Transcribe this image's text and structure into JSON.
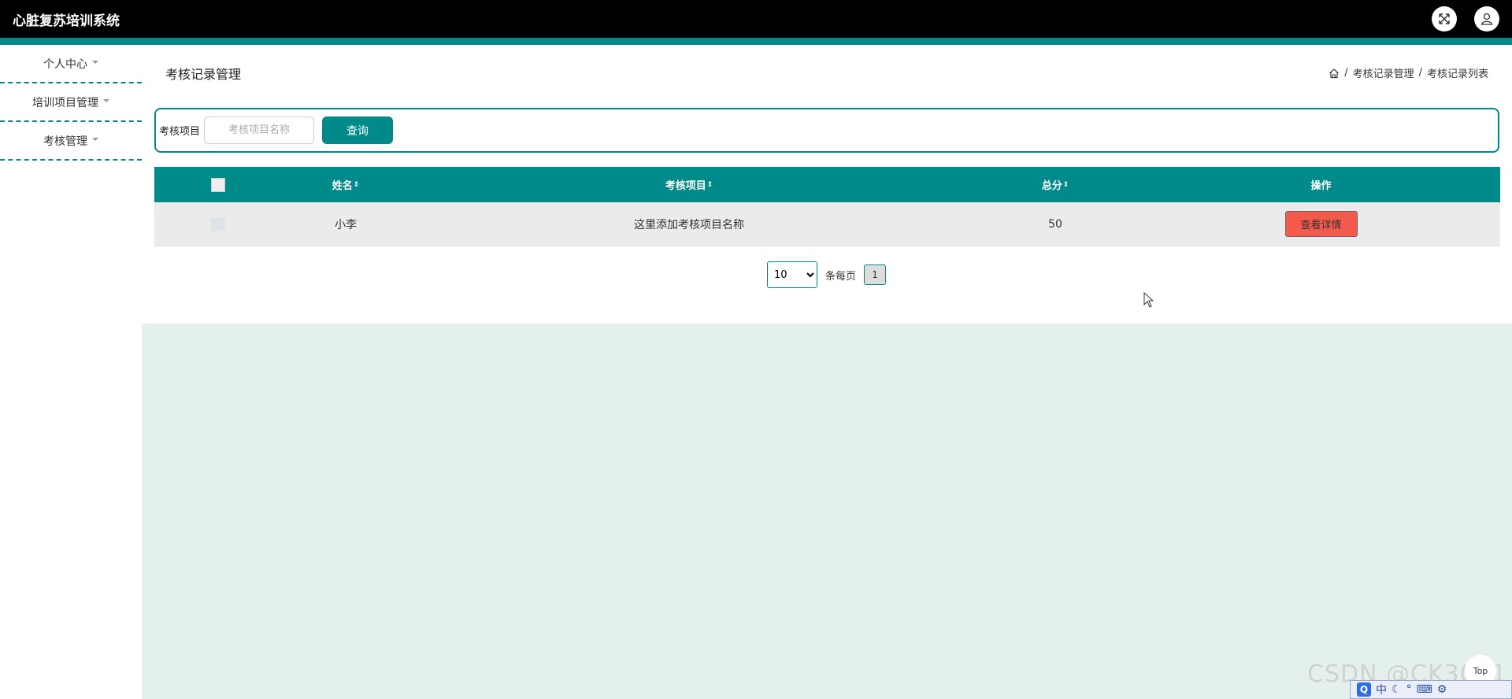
{
  "app": {
    "title": "心脏复苏培训系统"
  },
  "topbar_icons": [
    "fullscreen-icon",
    "user-icon"
  ],
  "sidebar": {
    "items": [
      {
        "label": "个人中心"
      },
      {
        "label": "培训项目管理"
      },
      {
        "label": "考核管理"
      }
    ]
  },
  "page": {
    "title": "考核记录管理",
    "breadcrumb": [
      "考核记录管理",
      "考核记录列表"
    ],
    "breadcrumb_sep": "/"
  },
  "search": {
    "label": "考核项目",
    "placeholder": "考核项目名称",
    "button": "查询"
  },
  "table": {
    "columns": [
      "姓名",
      "考核项目",
      "总分",
      "操作"
    ],
    "sort_icon": "⇕",
    "rows": [
      {
        "name": "小李",
        "project": "这里添加考核项目名称",
        "score": "50",
        "action": "查看详情"
      }
    ]
  },
  "pagination": {
    "page_size": "10",
    "page_size_options": [
      "10"
    ],
    "per_page_label": "条每页",
    "current_page": "1"
  },
  "overlay": {
    "watermark": "CSDN @CK3011",
    "top_button": "Top",
    "ime_label": "中"
  },
  "colors": {
    "accent": "#018a8a",
    "danger": "#f35a4b",
    "content_bg": "#e4f0ec"
  }
}
